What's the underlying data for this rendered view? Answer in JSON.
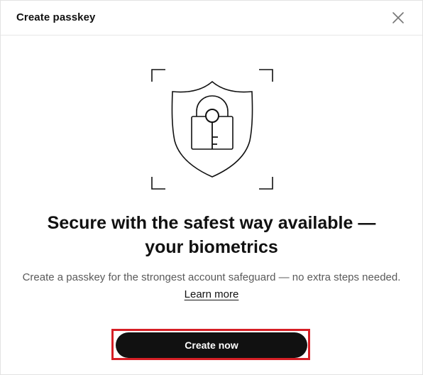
{
  "dialog": {
    "title": "Create passkey",
    "close_icon": "close-icon"
  },
  "illustration": {
    "icon": "shield-lock-key-icon"
  },
  "content": {
    "headline_line1": "Secure with the safest way available —",
    "headline_line2": "your biometrics",
    "description": "Create a passkey for the strongest account safeguard — no extra steps needed.",
    "learn_more": "Learn more"
  },
  "actions": {
    "primary_label": "Create now",
    "primary_highlight_color": "#d61f26"
  },
  "colors": {
    "button_bg": "#111111",
    "text_primary": "#111111",
    "text_secondary": "#5a5a5a"
  }
}
